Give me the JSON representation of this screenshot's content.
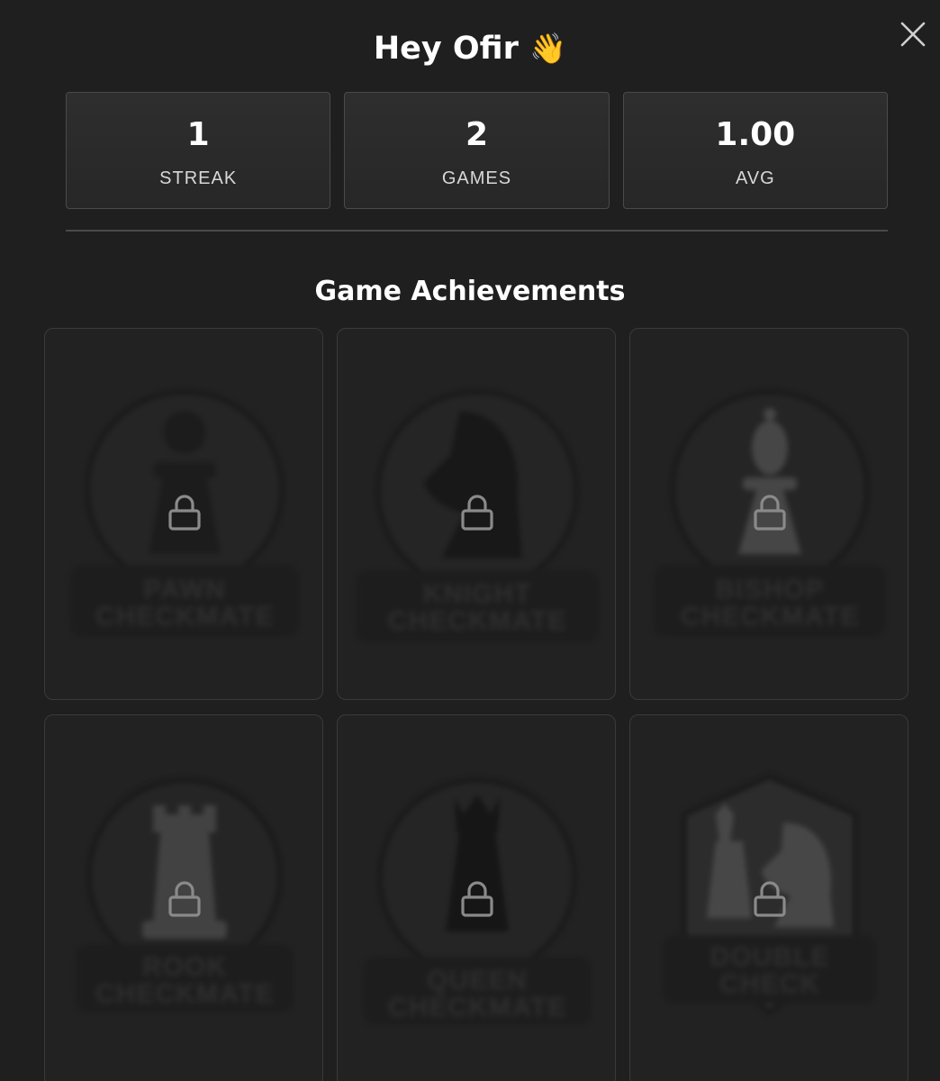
{
  "header": {
    "greeting": "Hey Ofir",
    "greeting_emoji": "👋",
    "close_icon": "close-icon"
  },
  "stats": [
    {
      "value": "1",
      "label": "STREAK"
    },
    {
      "value": "2",
      "label": "GAMES"
    },
    {
      "value": "1.00",
      "label": "AVG"
    }
  ],
  "achievements": {
    "title": "Game Achievements",
    "items": [
      {
        "label_line1": "PAWN",
        "label_line2": "CHECKMATE",
        "icon": "pawn-icon",
        "locked": true
      },
      {
        "label_line1": "KNIGHT",
        "label_line2": "CHECKMATE",
        "icon": "knight-icon",
        "locked": true
      },
      {
        "label_line1": "BISHOP",
        "label_line2": "CHECKMATE",
        "icon": "bishop-icon",
        "locked": true
      },
      {
        "label_line1": "ROOK",
        "label_line2": "CHECKMATE",
        "icon": "rook-icon",
        "locked": true
      },
      {
        "label_line1": "QUEEN",
        "label_line2": "CHECKMATE",
        "icon": "queen-icon",
        "locked": true
      },
      {
        "label_line1": "DOUBLE",
        "label_line2": "CHECK",
        "icon": "double-check-icon",
        "locked": true
      }
    ]
  },
  "colors": {
    "background": "#1f1f1f",
    "card_border": "#3a3a3a",
    "stat_border": "#4a4a4a",
    "text": "#ffffff",
    "muted_text": "#d8d8d8",
    "lock": "#8a8a8a"
  }
}
